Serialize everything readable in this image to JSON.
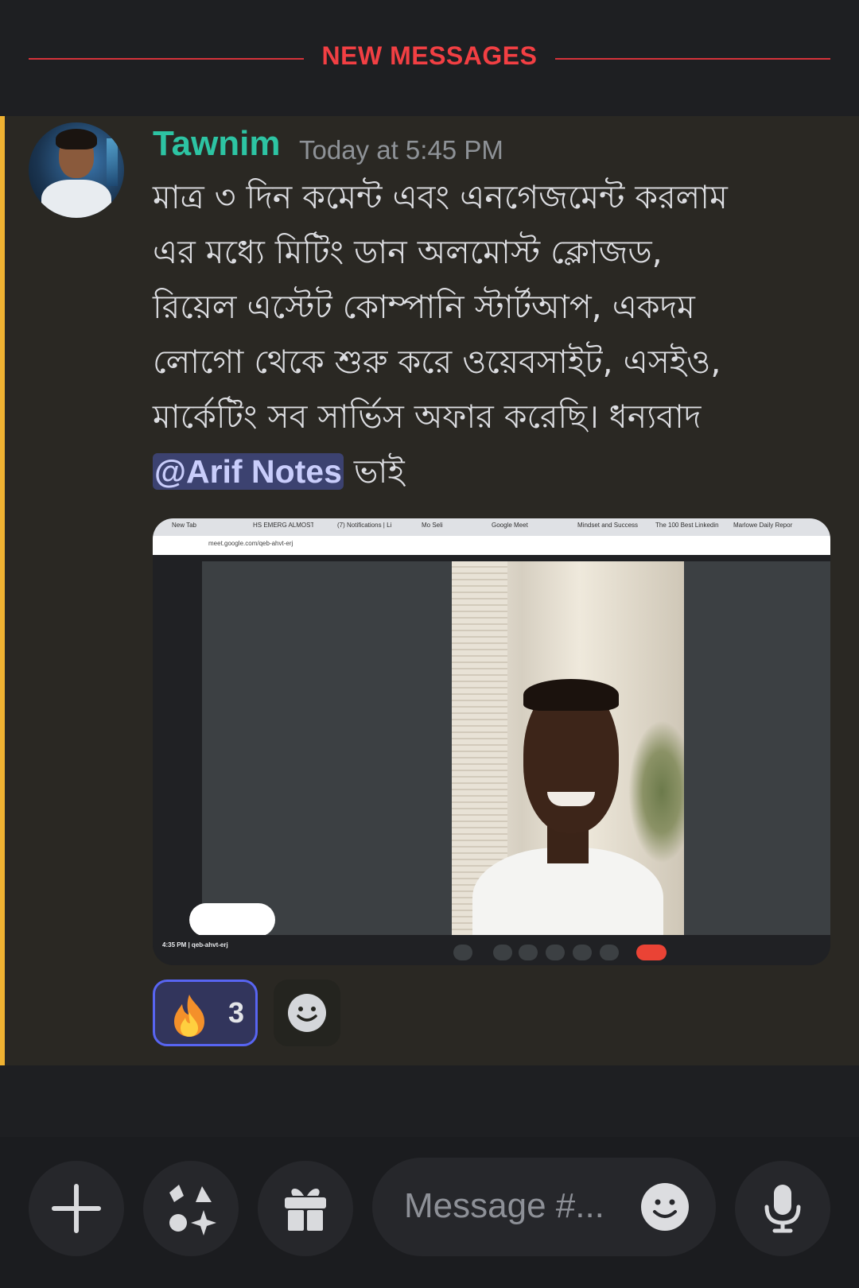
{
  "divider": {
    "label": "NEW MESSAGES"
  },
  "message": {
    "username": "Tawnim",
    "timestamp": "Today at 5:45 PM",
    "text_lines": [
      "মাত্র ৩ দিন কমেন্ট এবং এনগেজমেন্ট করলাম",
      "এর মধ্যে মিটিং ডান অলমোস্ট ক্লোজড,",
      "রিয়েল এস্টেট কোম্পানি স্টার্টআপ, একদম",
      "লোগো  থেকে শুরু করে ওয়েবসাইট, এসইও,",
      "মার্কেটিং সব সার্ভিস অফার করেছি। ধন্যবাদ"
    ],
    "mention": "@Arif Notes",
    "after_mention": " ভাই"
  },
  "attachment": {
    "tabs": [
      "New Tab",
      "HS EMERG ALMOST",
      "(7) Notifications | Li",
      "Mo Seli",
      "Google Meet",
      "Mindset and Success",
      "The 100 Best Linkedin",
      "Marlowe Daily Repor"
    ],
    "url": "meet.google.com/qeb-ahvt-erj",
    "meeting_time": "4:35 PM",
    "meeting_code": "qeb-ahvt-erj"
  },
  "reactions": [
    {
      "emoji": "🔥",
      "count": "3",
      "active": true
    }
  ],
  "composer": {
    "placeholder": "Message #...",
    "buttons": [
      "plus-icon",
      "apps-icon",
      "gift-icon",
      "emoji-icon",
      "microphone-icon"
    ]
  },
  "colors": {
    "accent_mention_bar": "#f0b232",
    "new_messages_red": "#f23f43",
    "username_color": "#2dc4a3",
    "reaction_border": "#5865f2"
  }
}
